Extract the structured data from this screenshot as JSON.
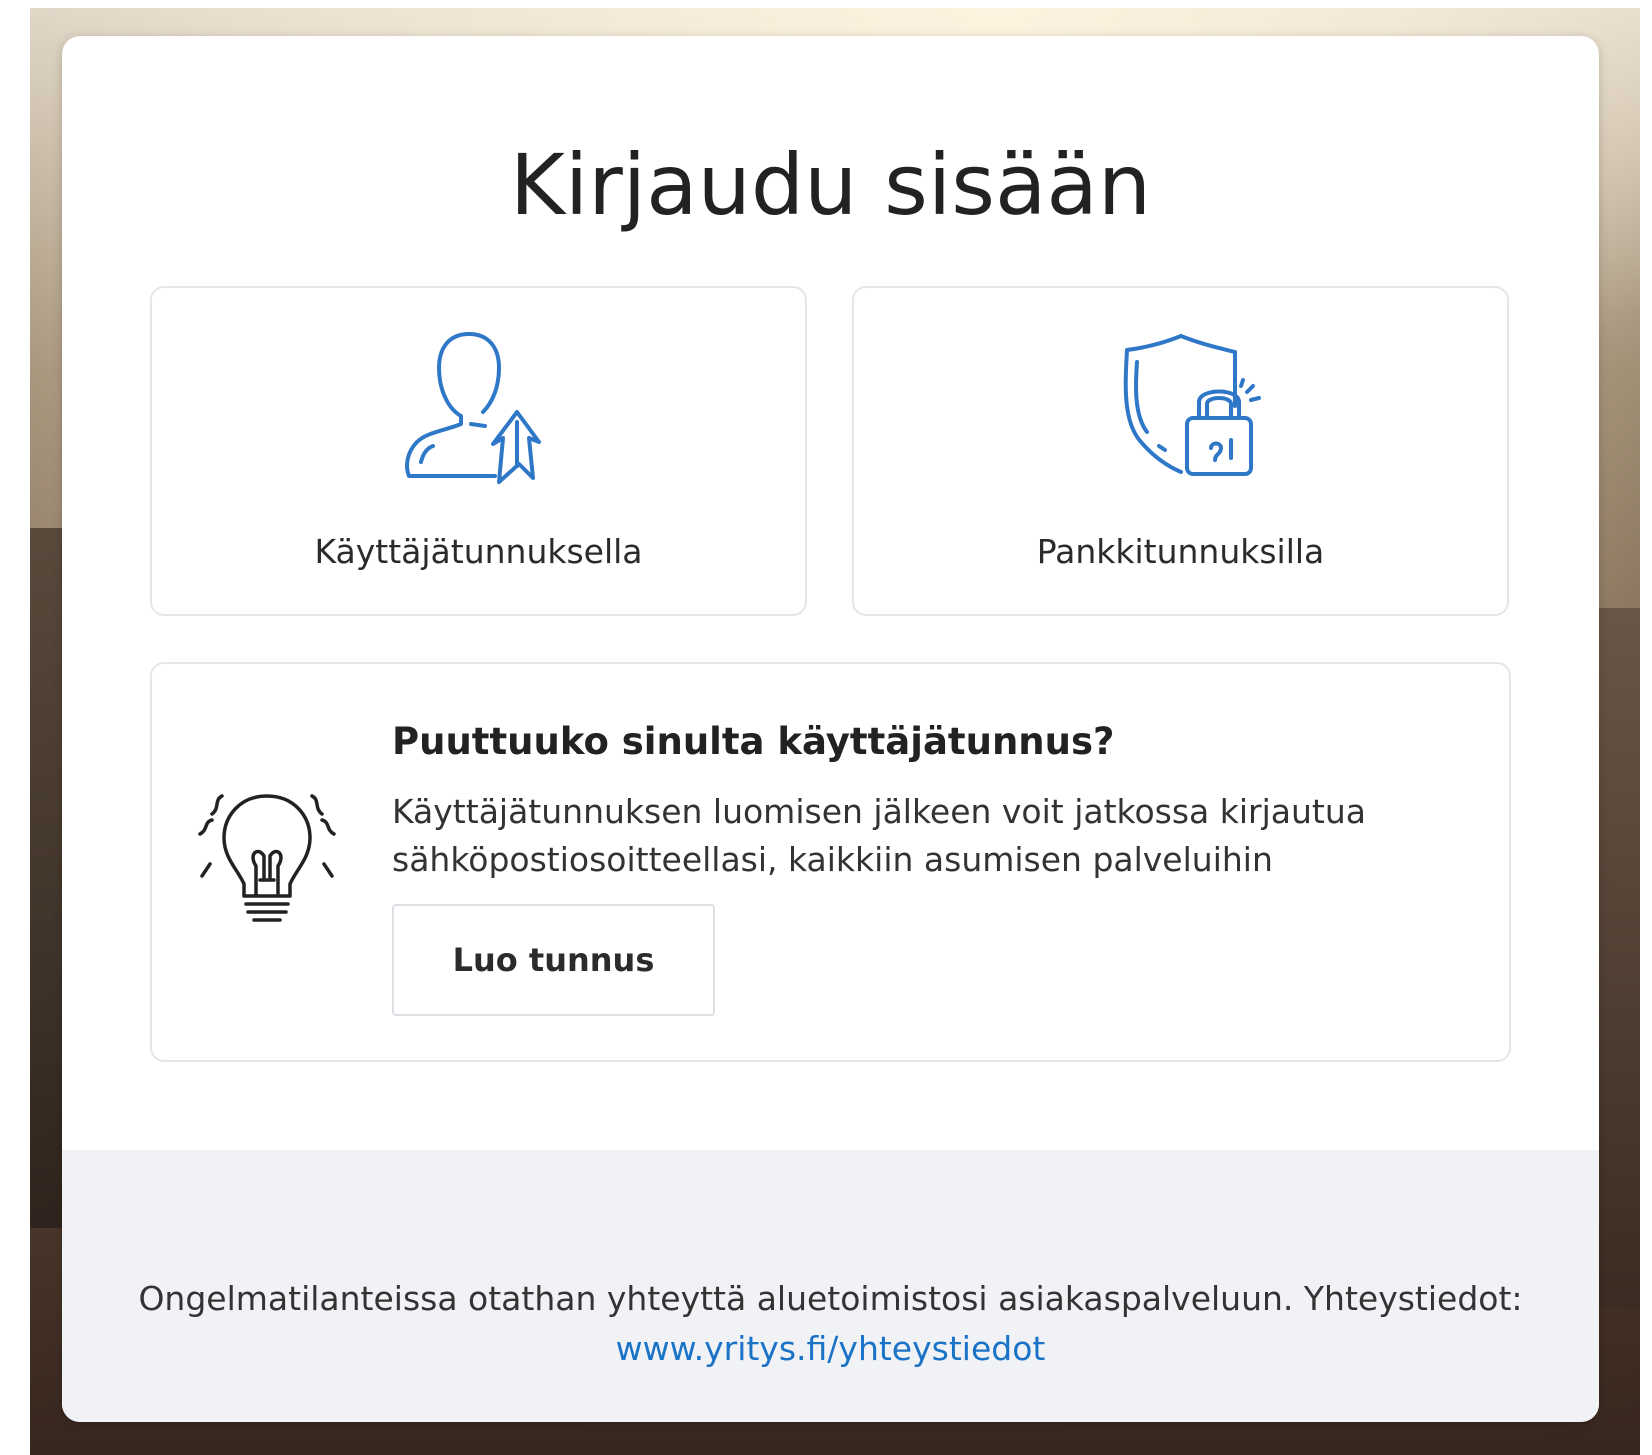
{
  "page": {
    "title": "Kirjaudu sisään"
  },
  "options": [
    {
      "label": "Käyttäjätunnuksella",
      "icon": "user-arrow-icon"
    },
    {
      "label": "Pankkitunnuksilla",
      "icon": "shield-lock-icon"
    }
  ],
  "info": {
    "icon": "lightbulb-icon",
    "heading": "Puuttuuko sinulta käyttäjätunnus?",
    "description": "Käyttäjätunnuksen luomisen jälkeen voit jatkossa kirjautua sähköpostiosoitteellasi, kaikkiin asumisen palveluihin",
    "button": "Luo tunnus"
  },
  "footer": {
    "text": "Ongelmatilanteissa otathan yhteyttä aluetoimistosi asiakaspalveluun. Yhteystiedot:",
    "link": "www.yritys.fi/yhteystiedot"
  },
  "colors": {
    "accent": "#1a73c6",
    "icon_blue": "#2f78c8",
    "footer_bg": "#f0f2f5"
  }
}
